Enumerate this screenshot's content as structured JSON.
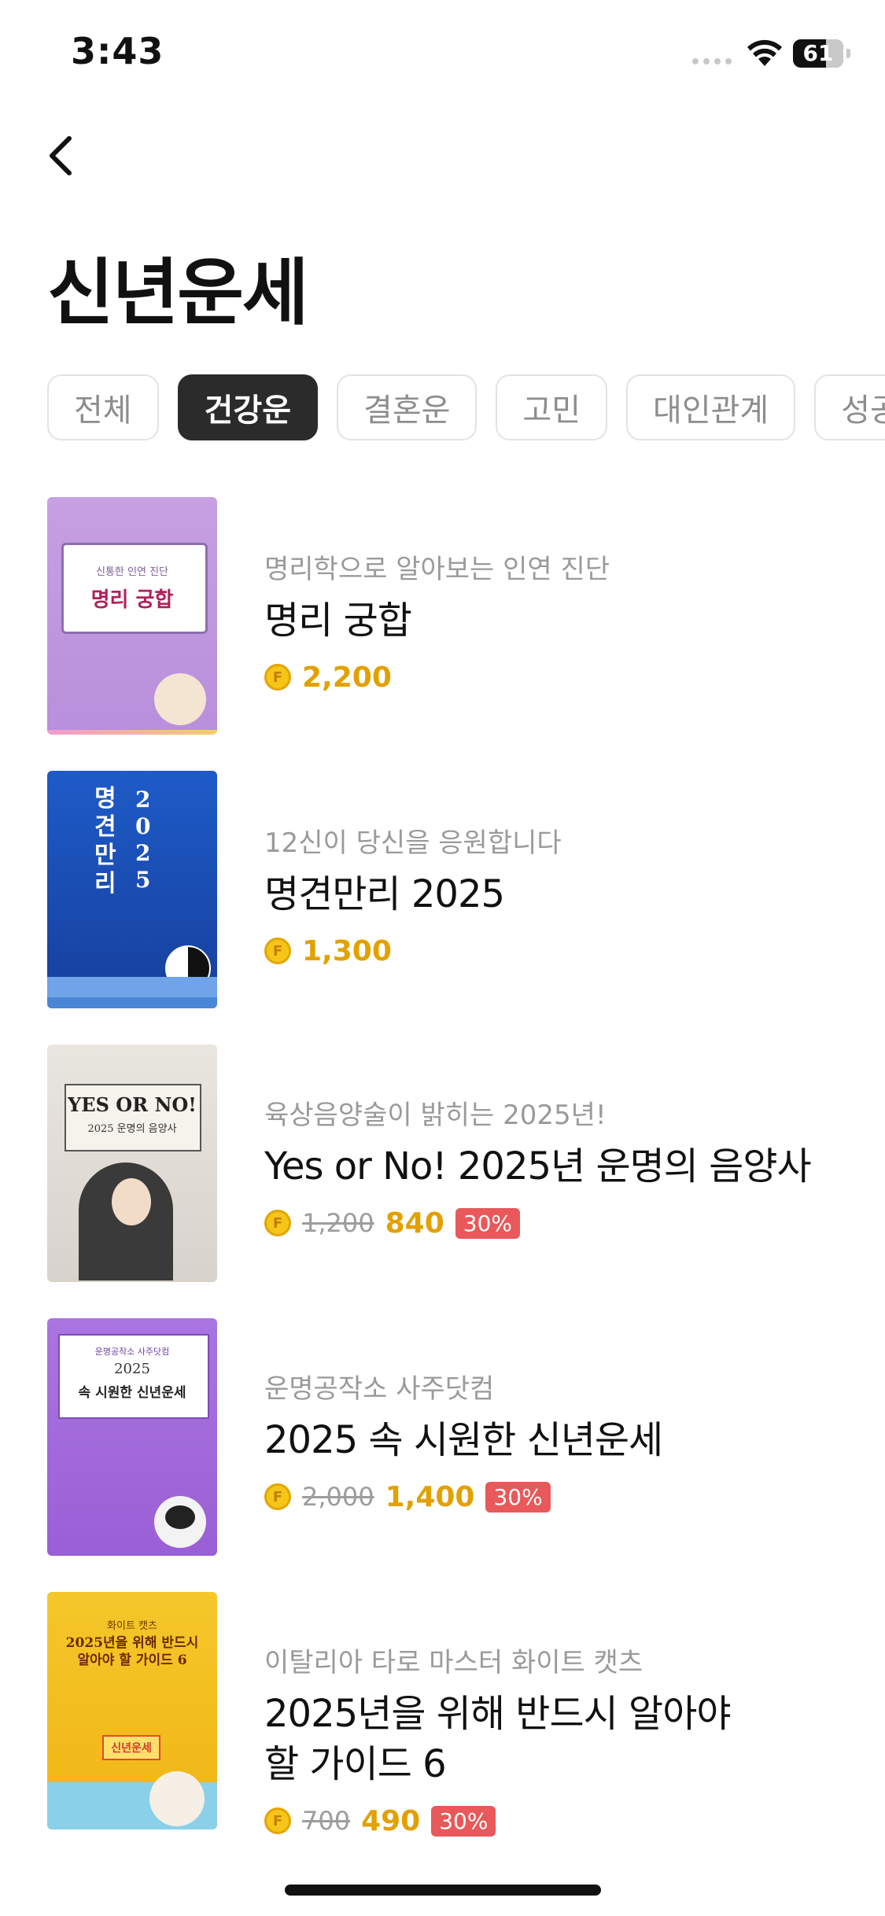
{
  "status_bar": {
    "time": "3:43",
    "battery": "61"
  },
  "header": {
    "title": "신년운세"
  },
  "tabs": [
    {
      "label": "전체",
      "active": false
    },
    {
      "label": "건강운",
      "active": true
    },
    {
      "label": "결혼운",
      "active": false
    },
    {
      "label": "고민",
      "active": false
    },
    {
      "label": "대인관계",
      "active": false
    },
    {
      "label": "성공",
      "active": false
    }
  ],
  "items": [
    {
      "subtitle": "명리학으로 알아보는 인연 진단",
      "name": "명리 궁합",
      "price": "2,200",
      "thumb": {
        "caption": "신통한 인연 진단",
        "title": "명리 궁합"
      }
    },
    {
      "subtitle": "12신이 당신을 응원합니다",
      "name": "명견만리 2025",
      "price": "1,300",
      "thumb": {
        "title": "명견만리",
        "year": "2025"
      }
    },
    {
      "subtitle": "육상음양술이 밝히는 2025년!",
      "name": "Yes or No! 2025년 운명의 음양사",
      "original_price": "1,200",
      "price": "840",
      "discount": "30%",
      "thumb": {
        "title": "YES OR NO!",
        "caption": "2025 운명의 음양사"
      }
    },
    {
      "subtitle": "운명공작소 사주닷컴",
      "name": "2025 속 시원한 신년운세",
      "original_price": "2,000",
      "price": "1,400",
      "discount": "30%",
      "thumb": {
        "caption": "운명공작소 사주닷컴",
        "year": "2025",
        "title": "속 시원한 신년운세"
      }
    },
    {
      "subtitle": "이탈리아 타로 마스터 화이트 캣츠",
      "name": "2025년을 위해 반드시 알아야 할 가이드 6",
      "original_price": "700",
      "price": "490",
      "discount": "30%",
      "thumb": {
        "caption": "화이트 캣츠",
        "title": "2025년을 위해 반드시 알아야 할 가이드 6",
        "badge": "신년운세"
      }
    }
  ],
  "coin_symbol": "F",
  "colors": {
    "price": "#e2a100",
    "discount": "#e9585a",
    "active_tab": "#2b2b2b"
  }
}
